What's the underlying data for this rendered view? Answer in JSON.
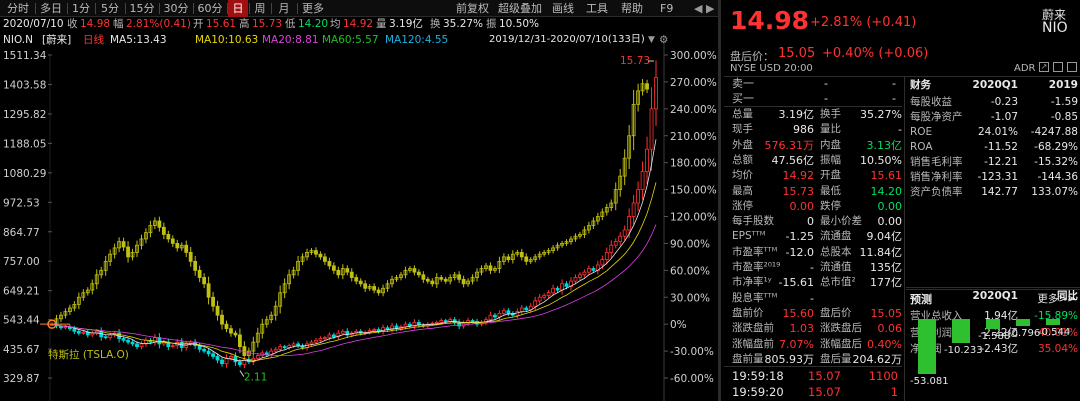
{
  "colors": {
    "up": "#ff3232",
    "down": "#00d8d8",
    "candle_up": "#c0c010",
    "ma5": "#e8e8e8",
    "ma10": "#e8d800",
    "ma20": "#e040e0",
    "ma60": "#20c020",
    "ma120": "#20b0e0",
    "compare": "#d8d8d8"
  },
  "toolbar": {
    "timeframes": [
      "分时",
      "多日",
      "1分",
      "5分",
      "15分",
      "30分",
      "60分",
      "日",
      "周",
      "月",
      "更多"
    ],
    "active_index": 7,
    "right_items": [
      "前复权",
      "超级叠加",
      "画线",
      "工具",
      "帮助",
      "F9"
    ],
    "nav_icons": [
      "nav-prev-icon",
      "nav-next-icon"
    ]
  },
  "info": {
    "date": "2020/07/10",
    "close_label": "收",
    "close": "14.98",
    "change_label": "幅",
    "change": "2.81%(0.41)",
    "open_label": "开",
    "open": "15.61",
    "high_label": "高",
    "high": "15.73",
    "low_label": "低",
    "low": "14.20",
    "avg_label": "均",
    "avg": "14.92",
    "vol_label": "量",
    "vol": "3.19亿",
    "turnover_label": "换",
    "turnover": "35.27%",
    "amp_label": "振",
    "amp": "10.50%"
  },
  "ma_row": {
    "symbol": "NIO.N",
    "adjust": "[蔚来]",
    "period": "日线",
    "ma5": "MA5:13.43",
    "ma10": "MA10:10.63",
    "ma20": "MA20:8.81",
    "ma60": "MA60:5.57",
    "ma120": "MA120:4.55",
    "range": "2019/12/31-2020/07/10(133日)",
    "icons": [
      "menu-icon",
      "gear-icon"
    ]
  },
  "chart": {
    "y_left_ticks": [
      "1511.34",
      "1403.58",
      "1295.82",
      "1188.05",
      "1080.29",
      "972.53",
      "864.77",
      "757.00",
      "649.21",
      "543.44",
      "435.67",
      "329.87"
    ],
    "y_right_ticks": [
      "300.00%",
      "270.00%",
      "240.00%",
      "210.00%",
      "180.00%",
      "150.00%",
      "120.00%",
      "90.00%",
      "60.00%",
      "30.00%",
      "0%",
      "-30.00%",
      "-60.00%"
    ],
    "high_label": "15.73",
    "low_label": "2.11",
    "compare_label": "特斯拉 (TSLA.O)",
    "current_left": "543.44"
  },
  "chart_data": {
    "type": "candlestick",
    "x_range": [
      "2019/12/31",
      "2020/07/10"
    ],
    "series": [
      {
        "name": "NIO.N",
        "kind": "percent",
        "values": [
          0,
          -2,
          -4,
          -3,
          -5,
          -8,
          -10,
          -9,
          -12,
          -10,
          -8,
          -14,
          -15,
          -12,
          -10,
          -16,
          -18,
          -20,
          -22,
          -25,
          -22,
          -18,
          -20,
          -15,
          -22,
          -20,
          -25,
          -24,
          -20,
          -26,
          -22,
          -20,
          -24,
          -28,
          -30,
          -33,
          -36,
          -40,
          -44,
          -38,
          -36,
          -42,
          -45,
          -40,
          -42,
          -38,
          -35,
          -32,
          -34,
          -30,
          -28,
          -25,
          -26,
          -24,
          -22,
          -24,
          -26,
          -22,
          -20,
          -18,
          -16,
          -15,
          -12,
          -14,
          -10,
          -8,
          -12,
          -10,
          -8,
          -10,
          -9,
          -7,
          -6,
          -8,
          -4,
          -6,
          -2,
          -5,
          -3,
          0,
          -2,
          2,
          -1,
          -2,
          0,
          1,
          2,
          4,
          3,
          5,
          2,
          -2,
          1,
          4,
          3,
          0,
          2,
          5,
          10,
          8,
          12,
          15,
          12,
          10,
          14,
          18,
          16,
          20,
          26,
          30,
          32,
          35,
          40,
          38,
          45,
          42,
          48,
          52,
          55,
          58,
          62,
          60,
          66,
          72,
          80,
          88,
          92,
          98,
          105,
          120,
          135,
          150,
          170,
          195,
          240,
          275
        ]
      },
      {
        "name": "特斯拉 (TSLA.O)",
        "kind": "percent",
        "values": [
          0,
          6,
          10,
          14,
          18,
          22,
          30,
          35,
          38,
          45,
          55,
          60,
          70,
          78,
          85,
          92,
          86,
          75,
          80,
          88,
          95,
          102,
          110,
          115,
          108,
          100,
          95,
          90,
          85,
          88,
          80,
          70,
          60,
          52,
          45,
          30,
          20,
          10,
          0,
          -5,
          -10,
          -12,
          -25,
          -35,
          -30,
          -20,
          -10,
          0,
          5,
          10,
          20,
          35,
          45,
          55,
          60,
          70,
          75,
          80,
          82,
          78,
          75,
          70,
          65,
          60,
          55,
          62,
          58,
          52,
          48,
          45,
          40,
          42,
          38,
          35,
          40,
          45,
          50,
          52,
          55,
          60,
          62,
          58,
          55,
          50,
          48,
          45,
          52,
          50,
          48,
          52,
          55,
          50,
          45,
          48,
          52,
          58,
          62,
          65,
          60,
          62,
          70,
          75,
          72,
          78,
          80,
          75,
          70,
          72,
          75,
          78,
          80,
          82,
          85,
          88,
          90,
          92,
          95,
          98,
          100,
          105,
          110,
          115,
          120,
          125,
          130,
          135,
          150,
          165,
          185,
          210,
          245,
          260,
          268,
          262
        ]
      }
    ],
    "y_right_range": [
      -60,
      300
    ],
    "y_left_range": [
      329.87,
      1511.34
    ]
  },
  "quote": {
    "price": "14.98",
    "change": "+2.81% (+0.41)",
    "name": "蔚来",
    "code": "NIO",
    "pre_label": "盘后价：",
    "pre_price": "15.05",
    "pre_change": "+0.40% (+0.06)",
    "exchange": "NYSE  USD  20:00",
    "adr": "ADR"
  },
  "orderbook": {
    "rows": [
      {
        "label": "卖一",
        "price": "-",
        "vol": "-"
      },
      {
        "label": "买一",
        "price": "-",
        "vol": "-"
      }
    ]
  },
  "stats": [
    [
      {
        "l": "总量",
        "v": "3.19亿",
        "c": "white"
      },
      {
        "l": "换手",
        "v": "35.27%",
        "c": "white"
      }
    ],
    [
      {
        "l": "现手",
        "v": "986",
        "c": "white"
      },
      {
        "l": "量比",
        "v": "-",
        "c": "white"
      }
    ],
    [
      {
        "l": "外盘",
        "v": "576.31万",
        "c": "red"
      },
      {
        "l": "内盘",
        "v": "3.13亿",
        "c": "green"
      }
    ],
    [
      {
        "l": "总额",
        "v": "47.56亿",
        "c": "white"
      },
      {
        "l": "振幅",
        "v": "10.50%",
        "c": "white"
      }
    ],
    [
      {
        "l": "均价",
        "v": "14.92",
        "c": "red"
      },
      {
        "l": "开盘",
        "v": "15.61",
        "c": "red"
      }
    ],
    [
      {
        "l": "最高",
        "v": "15.73",
        "c": "red"
      },
      {
        "l": "最低",
        "v": "14.20",
        "c": "green"
      }
    ],
    [
      {
        "l": "涨停",
        "v": "0.00",
        "c": "red"
      },
      {
        "l": "跌停",
        "v": "0.00",
        "c": "green"
      }
    ],
    [
      {
        "l": "每手股数",
        "v": "0",
        "c": "white"
      },
      {
        "l": "最小价差",
        "v": "0.00",
        "c": "white"
      }
    ],
    [
      {
        "l": "EPSᵀᵀᴹ",
        "v": "-1.25",
        "c": "white"
      },
      {
        "l": "流通盘",
        "v": "9.04亿",
        "c": "white"
      }
    ],
    [
      {
        "l": "市盈率ᵀᵀᴹ",
        "v": "-12.0",
        "c": "white"
      },
      {
        "l": "总股本",
        "v": "11.84亿",
        "c": "white"
      }
    ],
    [
      {
        "l": "市盈率²⁰¹⁹",
        "v": "-",
        "c": "white"
      },
      {
        "l": "流通值",
        "v": "135亿",
        "c": "white"
      }
    ],
    [
      {
        "l": "市净率¹ʸ",
        "v": "-15.61",
        "c": "white"
      },
      {
        "l": "总市值²",
        "v": "177亿",
        "c": "white"
      }
    ],
    [
      {
        "l": "股息率ᵀᵀᴹ",
        "v": "-",
        "c": "white"
      },
      {
        "l": "",
        "v": "",
        "c": "white"
      }
    ],
    [
      {
        "l": "盘前价",
        "v": "15.60",
        "c": "red"
      },
      {
        "l": "盘后价",
        "v": "15.05",
        "c": "red"
      }
    ],
    [
      {
        "l": "涨跌盘前",
        "v": "1.03",
        "c": "red"
      },
      {
        "l": "涨跌盘后",
        "v": "0.06",
        "c": "red"
      }
    ],
    [
      {
        "l": "涨幅盘前",
        "v": "7.07%",
        "c": "red"
      },
      {
        "l": "涨幅盘后",
        "v": "0.40%",
        "c": "red"
      }
    ],
    [
      {
        "l": "盘前量",
        "v": "805.93万",
        "c": "white"
      },
      {
        "l": "盘后量",
        "v": "204.62万",
        "c": "white"
      }
    ]
  ],
  "trades": [
    {
      "time": "19:59:18",
      "price": "15.07",
      "vol": "1100"
    },
    {
      "time": "19:59:20",
      "price": "15.07",
      "vol": "1"
    }
  ],
  "finance": {
    "header": {
      "label": "财务",
      "col1": "2020Q1",
      "col2": "2019"
    },
    "rows": [
      {
        "l": "每股收益",
        "a": "-0.23",
        "b": "-1.59",
        "ca": "white",
        "cb": "white"
      },
      {
        "l": "每股净资产",
        "a": "-1.07",
        "b": "-0.85",
        "ca": "white",
        "cb": "white"
      },
      {
        "l": "ROE",
        "a": "24.01%",
        "b": "-4247.88",
        "ca": "white",
        "cb": "white"
      },
      {
        "l": "ROA",
        "a": "-11.52",
        "b": "-68.29%",
        "ca": "white",
        "cb": "white"
      },
      {
        "l": "销售毛利率",
        "a": "-12.21",
        "b": "-15.32%",
        "ca": "white",
        "cb": "white"
      },
      {
        "l": "销售净利率",
        "a": "-123.31",
        "b": "-144.36",
        "ca": "white",
        "cb": "white"
      },
      {
        "l": "资产负债率",
        "a": "142.77",
        "b": "133.07%",
        "ca": "white",
        "cb": "white"
      }
    ],
    "header2": {
      "col1": "2020Q1",
      "col2": "同比"
    },
    "rows2": [
      {
        "l": "营业总收入",
        "a": "1.94亿",
        "b": "-15.89%",
        "ca": "white",
        "cb": "green"
      },
      {
        "l": "营业利润",
        "a": "-2.22亿",
        "b": "40.01%",
        "ca": "white",
        "cb": "red"
      },
      {
        "l": "净利润",
        "a": "-2.43亿",
        "b": "35.04%",
        "ca": "white",
        "cb": "red"
      }
    ]
  },
  "forecast": {
    "title": "预测",
    "more": "更多>>",
    "bars": [
      {
        "v": -53.081,
        "label": "-53.081"
      },
      {
        "v": -10.233,
        "label": "-10.233"
      },
      {
        "v": -1.588,
        "label": "-1.588"
      },
      {
        "v": -0.796,
        "label": "-0.796"
      },
      {
        "v": -0.544,
        "label": "-0.544"
      }
    ]
  }
}
